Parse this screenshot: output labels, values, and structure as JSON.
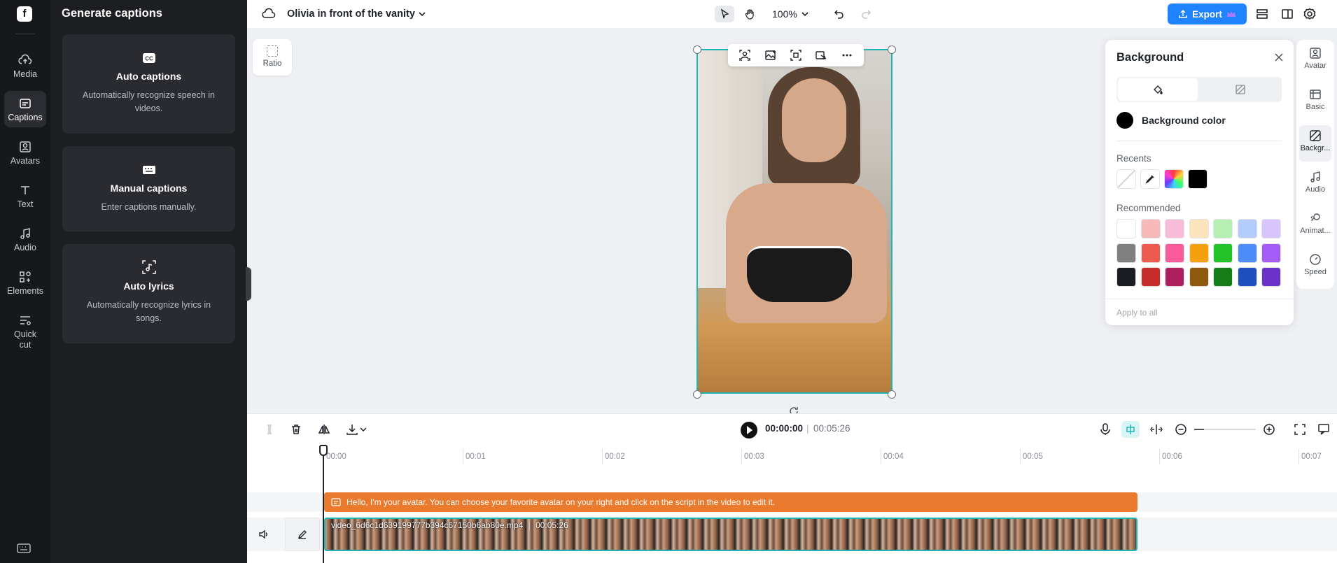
{
  "nav": {
    "items": [
      {
        "label": "Media",
        "icon": "cloud-upload-icon"
      },
      {
        "label": "Captions",
        "icon": "captions-icon",
        "active": true
      },
      {
        "label": "Avatars",
        "icon": "avatar-icon"
      },
      {
        "label": "Text",
        "icon": "text-icon"
      },
      {
        "label": "Audio",
        "icon": "music-note-icon"
      },
      {
        "label": "Elements",
        "icon": "elements-icon"
      },
      {
        "label": "Quick cut",
        "icon": "quick-cut-icon"
      }
    ]
  },
  "captions_panel": {
    "title": "Generate captions",
    "cards": [
      {
        "title": "Auto captions",
        "description": "Automatically recognize speech in videos.",
        "icon": "cc-icon"
      },
      {
        "title": "Manual captions",
        "description": "Enter captions manually.",
        "icon": "keyboard-icon"
      },
      {
        "title": "Auto lyrics",
        "description": "Automatically recognize lyrics in songs.",
        "icon": "lyrics-icon"
      }
    ]
  },
  "topbar": {
    "project_title": "Olivia in front of the vanity",
    "zoom": "100%",
    "export_label": "Export"
  },
  "canvas": {
    "ratio_label": "Ratio"
  },
  "background_panel": {
    "title": "Background",
    "background_color_label": "Background color",
    "recents_label": "Recents",
    "recommended_label": "Recommended",
    "apply_all_label": "Apply to all",
    "recents": [
      "none",
      "eyedropper",
      "gradient",
      "#000000"
    ],
    "recommended": [
      "#ffffff",
      "#f7b8b8",
      "#f8bcd8",
      "#fbe3bc",
      "#b5f0b2",
      "#b3ccfb",
      "#d9c4fb",
      "#808080",
      "#ef5a50",
      "#fb5a9a",
      "#f5a10f",
      "#22c429",
      "#4d8dfb",
      "#a45cf7",
      "#1c1d22",
      "#c62b2b",
      "#ad1f5c",
      "#8d5a0c",
      "#157d17",
      "#1f4ebf",
      "#6b32c7"
    ]
  },
  "right_rail": {
    "items": [
      {
        "label": "Avatar",
        "icon": "avatar-icon"
      },
      {
        "label": "Basic",
        "icon": "basic-icon"
      },
      {
        "label": "Backgr...",
        "icon": "background-icon",
        "active": true
      },
      {
        "label": "Audio",
        "icon": "music-note-icon"
      },
      {
        "label": "Animat...",
        "icon": "animation-icon"
      },
      {
        "label": "Speed",
        "icon": "speed-icon"
      }
    ]
  },
  "timeline": {
    "current_time": "00:00:00",
    "separator": "|",
    "total_time": "00:05:26",
    "ruler": [
      "00:00",
      "00:01",
      "00:02",
      "00:03",
      "00:04",
      "00:05",
      "00:06",
      "00:07"
    ],
    "text_clip": "Hello, I'm your avatar. You can choose your favorite avatar on your right and click on the script in the video to edit it.",
    "video_clip_label": "video_6d6c1d639199777b394c67150b6ab80e.mp4",
    "video_clip_duration": "00:05:26"
  }
}
